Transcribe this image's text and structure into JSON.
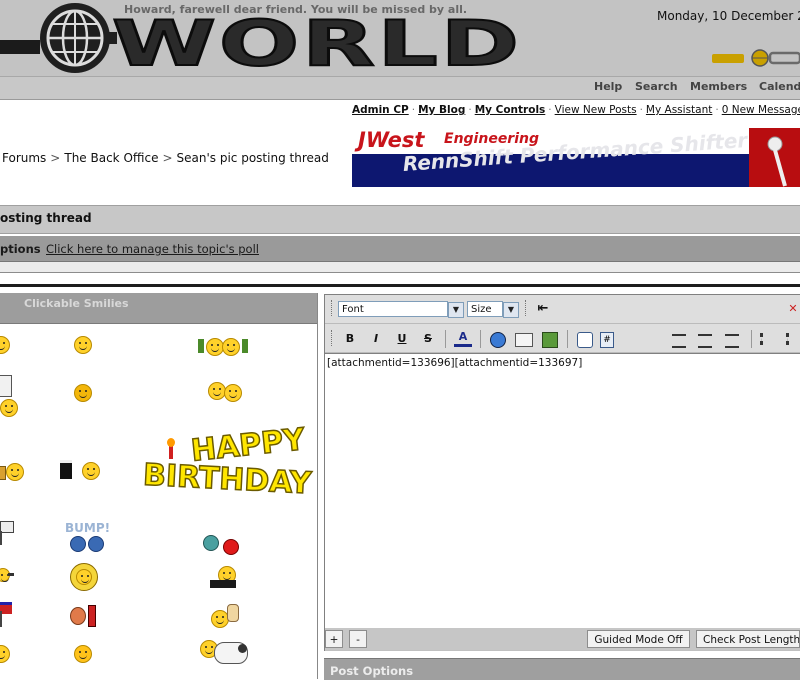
{
  "header": {
    "tagline": "Howard, farewell dear friend.  You will be missed by all.",
    "date": "Monday, 10 December 20",
    "logo_text": "WORLD",
    "nav": [
      "Help",
      "Search",
      "Members",
      "Calend"
    ]
  },
  "user_links": [
    {
      "label": "Admin CP",
      "bold": true
    },
    {
      "label": "My Blog",
      "bold": true
    },
    {
      "label": "My Controls",
      "bold": true
    },
    {
      "label": "View New Posts",
      "bold": false
    },
    {
      "label": "My Assistant",
      "bold": false
    },
    {
      "label": "0 New Message",
      "bold": false
    }
  ],
  "breadcrumb": [
    "Forums",
    "The Back Office",
    "Sean's pic posting thread"
  ],
  "banner": {
    "brand": "JWest",
    "subtitle": "Engineering",
    "product": "RennShift Performance Shifter"
  },
  "thread": {
    "title": "osting thread",
    "options_label": "ptions",
    "options_link": "Click here to manage this topic's poll"
  },
  "smilies": {
    "title": "Clickable Smilies",
    "bump_label": "BUMP!",
    "birthday_line1": "HAPPY",
    "birthday_line2": "BIRTHDAY"
  },
  "editor": {
    "font_select": "Font",
    "size_select": "Size",
    "format_buttons": [
      "B",
      "I",
      "U",
      "S"
    ],
    "content": "[attachmentid=133696][attachmentid=133697]",
    "plus": "+",
    "minus": "-",
    "guided_mode": "Guided Mode Off",
    "check_length": "Check Post Length"
  },
  "post_options": {
    "label": "Post Options"
  }
}
